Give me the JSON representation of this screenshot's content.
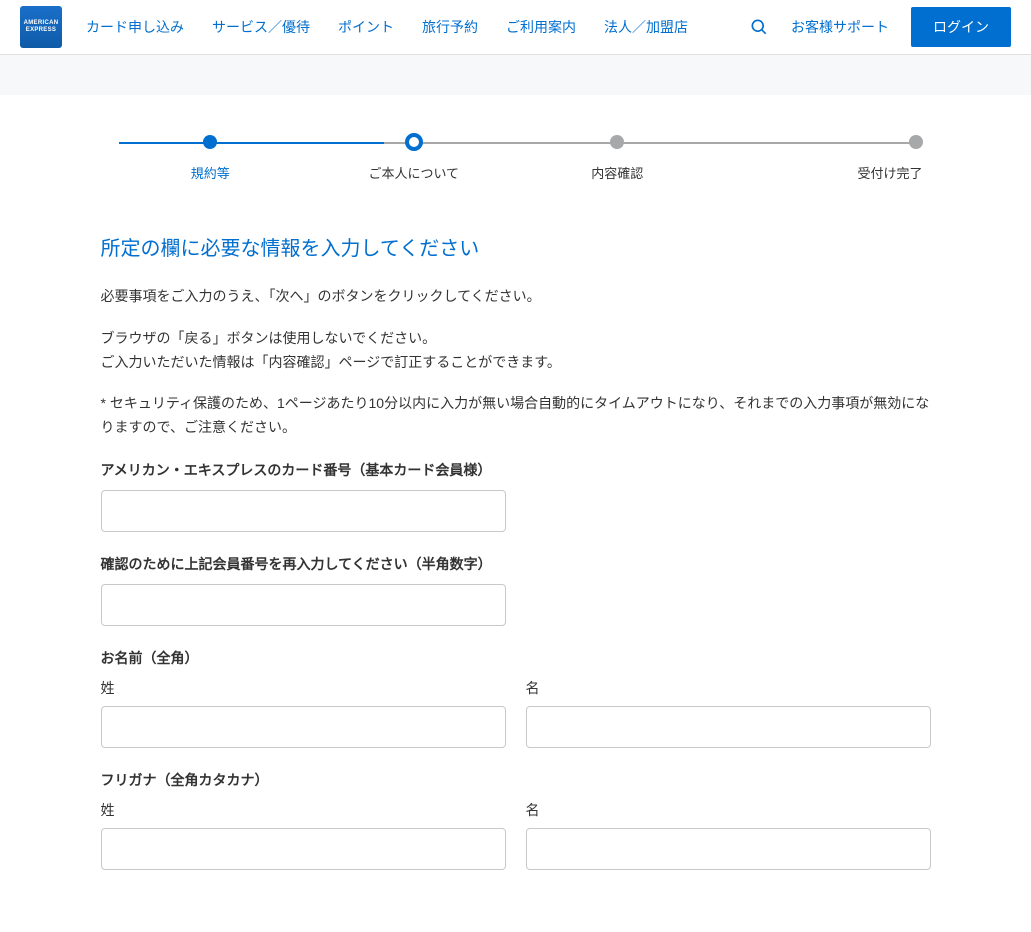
{
  "header": {
    "logo_text": "AMERICAN EXPRESS",
    "nav": [
      "カード申し込み",
      "サービス／優待",
      "ポイント",
      "旅行予約",
      "ご利用案内",
      "法人／加盟店"
    ],
    "support": "お客様サポート",
    "login": "ログイン"
  },
  "stepper": {
    "steps": [
      "規約等",
      "ご本人について",
      "内容確認",
      "受付け完了"
    ],
    "done_index": 0,
    "current_index": 1
  },
  "page": {
    "title": "所定の欄に必要な情報を入力してください",
    "intro1": "必要事項をご入力のうえ、「次へ」のボタンをクリックしてください。",
    "intro2": "ブラウザの「戻る」ボタンは使用しないでください。\nご入力いただいた情報は「内容確認」ページで訂正することができます。",
    "intro3": "* セキュリティ保護のため、1ページあたり10分以内に入力が無い場合自動的にタイムアウトになり、それまでの入力事項が無効になりますので、ご注意ください。"
  },
  "form": {
    "card_number_label": "アメリカン・エキスプレスのカード番号（基本カード会員様）",
    "card_number_value": "",
    "card_number_confirm_label": "確認のために上記会員番号を再入力してください（半角数字）",
    "card_number_confirm_value": "",
    "name_label": "お名前（全角）",
    "last_name_label": "姓",
    "first_name_label": "名",
    "last_name_value": "",
    "first_name_value": "",
    "kana_label": "フリガナ（全角カタカナ）",
    "kana_last_label": "姓",
    "kana_first_label": "名",
    "kana_last_value": "",
    "kana_first_value": ""
  }
}
